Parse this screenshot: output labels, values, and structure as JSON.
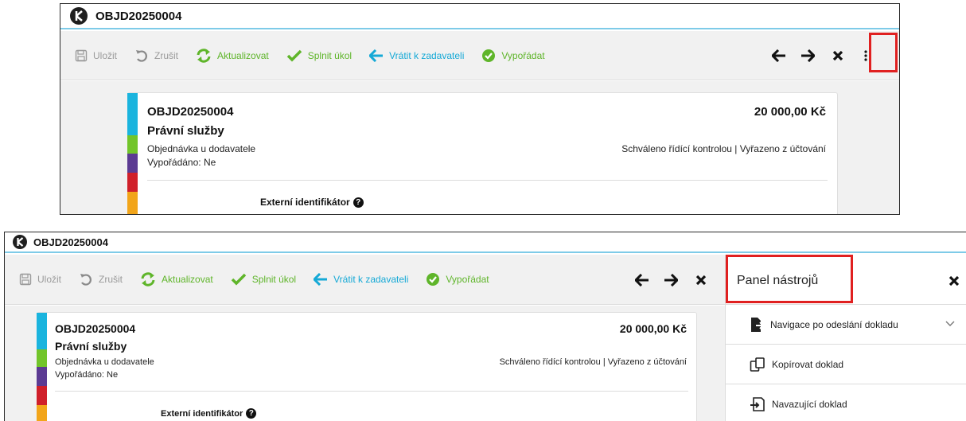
{
  "window": {
    "title": "OBJD20250004"
  },
  "toolbar": {
    "save_label": "Uložit",
    "cancel_label": "Zrušit",
    "refresh_label": "Aktualizovat",
    "complete_task_label": "Splnit úkol",
    "return_label": "Vrátit k zadavateli",
    "settle_label": "Vypořádat"
  },
  "document": {
    "id": "OBJD20250004",
    "name": "Právní služby",
    "type": "Objednávka u dodavatele",
    "settled": "Vypořádáno: Ne",
    "amount": "20 000,00 Kč",
    "status": "Schváleno řídící kontrolou | Vyřazeno z účtování",
    "external_id_label": "Externí identifikátor"
  },
  "status_colors": [
    "#1ab4de",
    "#1ab4de",
    "#72c52a",
    "#5c3b93",
    "#d0202a",
    "#f2a51a"
  ],
  "panel": {
    "title": "Panel nástrojů",
    "items": [
      {
        "label": "Navigace po odeslání dokladu",
        "icon": "send-document-icon"
      },
      {
        "label": "Kopírovat doklad",
        "icon": "copy-document-icon"
      },
      {
        "label": "Navazující doklad",
        "icon": "linked-document-icon"
      }
    ]
  }
}
